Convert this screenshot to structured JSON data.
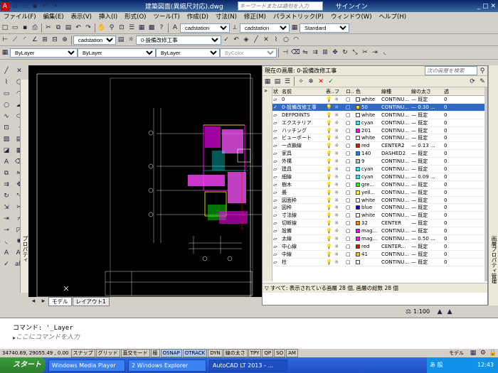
{
  "title": {
    "app_title": "建築図面(異縮尺対応).dwg",
    "search_placeholder": "キーワードまたは語句を入力",
    "signin": "サインイン"
  },
  "menu": [
    "ファイル(F)",
    "編集(E)",
    "表示(V)",
    "挿入(I)",
    "形式(O)",
    "ツール(T)",
    "作成(D)",
    "寸法(N)",
    "修正(M)",
    "パラメトリック(P)",
    "ウィンドウ(W)",
    "ヘルプ(H)"
  ],
  "toolbar": {
    "layer_current": "0-設備改修工事",
    "textstyle": "cadstation",
    "dimstyle": "cadstation",
    "tablestyle": "Standard",
    "multileader": "cadstation",
    "color": "ByLayer",
    "linetype": "ByLayer",
    "lineweight": "ByLayer",
    "plotstyle": "ByColor"
  },
  "palette": {
    "properties_label": "プロパティ",
    "layer_manager_label": "画層プロパティ管理"
  },
  "layers": {
    "current_layer": "現在の画層: 0-設備改修工事",
    "search_placeholder": "次の画層を検索",
    "headers": [
      "状",
      "名前",
      "表..",
      "フリ..",
      "ロ..",
      "色",
      "線種",
      "線の太さ",
      "透"
    ],
    "rows": [
      {
        "name": "0",
        "color": "white",
        "swatch": "#ffffff",
        "ltype": "CONTINU...",
        "lw": "既定",
        "tr": "0",
        "sel": false
      },
      {
        "name": "0-設備改修工事",
        "color": "50",
        "swatch": "#ffd400",
        "ltype": "CONTINU...",
        "lw": "0.30 ...",
        "tr": "0",
        "sel": true
      },
      {
        "name": "DEFPOINTS",
        "color": "white",
        "swatch": "#ffffff",
        "ltype": "CONTINU...",
        "lw": "既定",
        "tr": "0",
        "sel": false
      },
      {
        "name": "エクステリア",
        "color": "cyan",
        "swatch": "#00ffff",
        "ltype": "CONTINU...",
        "lw": "既定",
        "tr": "0",
        "sel": false
      },
      {
        "name": "ハッチング",
        "color": "201",
        "swatch": "#ff00ff",
        "ltype": "CONTINU...",
        "lw": "既定",
        "tr": "0",
        "sel": false
      },
      {
        "name": "ビューポート",
        "color": "white",
        "swatch": "#ffffff",
        "ltype": "CONTINU...",
        "lw": "既定",
        "tr": "0",
        "sel": false
      },
      {
        "name": "一点鎖線",
        "color": "red",
        "swatch": "#ff0000",
        "ltype": "CENTER2",
        "lw": "0.13 ...",
        "tr": "0",
        "sel": false
      },
      {
        "name": "家具",
        "color": "140",
        "swatch": "#0080ff",
        "ltype": "DASHED2",
        "lw": "既定",
        "tr": "0",
        "sel": false
      },
      {
        "name": "外構",
        "color": "9",
        "swatch": "#c0c0c0",
        "ltype": "CONTINU...",
        "lw": "既定",
        "tr": "0",
        "sel": false
      },
      {
        "name": "建具",
        "color": "cyan",
        "swatch": "#00ffff",
        "ltype": "CONTINU...",
        "lw": "既定",
        "tr": "0",
        "sel": false
      },
      {
        "name": "細線",
        "color": "cyan",
        "swatch": "#00ffff",
        "ltype": "CONTINU...",
        "lw": "0.09 ...",
        "tr": "0",
        "sel": false
      },
      {
        "name": "樹木",
        "color": "gre...",
        "swatch": "#00ff00",
        "ltype": "CONTINU...",
        "lw": "既定",
        "tr": "0",
        "sel": false
      },
      {
        "name": "畳",
        "color": "yell...",
        "swatch": "#ffff00",
        "ltype": "CONTINU...",
        "lw": "既定",
        "tr": "0",
        "sel": false
      },
      {
        "name": "図面枠",
        "color": "white",
        "swatch": "#ffffff",
        "ltype": "CONTINU...",
        "lw": "既定",
        "tr": "0",
        "sel": false
      },
      {
        "name": "図枠",
        "color": "blue",
        "swatch": "#0000ff",
        "ltype": "CONTINU...",
        "lw": "既定",
        "tr": "0",
        "sel": false
      },
      {
        "name": "寸法線",
        "color": "white",
        "swatch": "#ffffff",
        "ltype": "CONTINU...",
        "lw": "既定",
        "tr": "0",
        "sel": false
      },
      {
        "name": "切断線",
        "color": "32",
        "swatch": "#ff7f00",
        "ltype": "CENTER",
        "lw": "既定",
        "tr": "0",
        "sel": false
      },
      {
        "name": "設備",
        "color": "mag...",
        "swatch": "#ff00ff",
        "ltype": "CONTINU...",
        "lw": "既定",
        "tr": "0",
        "sel": false
      },
      {
        "name": "太線",
        "color": "mag...",
        "swatch": "#ff00ff",
        "ltype": "CONTINU...",
        "lw": "0.50 ...",
        "tr": "0",
        "sel": false
      },
      {
        "name": "中心線",
        "color": "red",
        "swatch": "#ff0000",
        "ltype": "CENTER...",
        "lw": "既定",
        "tr": "0",
        "sel": false
      },
      {
        "name": "中線",
        "color": "41",
        "swatch": "#ffbf00",
        "ltype": "CONTINU...",
        "lw": "既定",
        "tr": "0",
        "sel": false
      },
      {
        "name": "柱",
        "color": "",
        "swatch": "#ffffff",
        "ltype": "CONTINU...",
        "lw": "既定",
        "tr": "0",
        "sel": false
      }
    ],
    "footer": "すべて: 表示されている画層 28 個, 画層の総数 28 個"
  },
  "layout_tabs": [
    "モデル",
    "レイアウト1"
  ],
  "scale": "1:100",
  "command": {
    "history": "コマンド:  '_Layer",
    "prompt": "ここにコマンドを入力"
  },
  "status": {
    "coords": "34740.69, 29055.49 , 0.00",
    "toggles": [
      "スナップ",
      "グリッド",
      "直交モード",
      "極",
      "OSNAP",
      "OTRACK",
      "DYN",
      "線の太さ",
      "TPY",
      "QP",
      "SO",
      "AM"
    ],
    "on": [
      "OSNAP",
      "OTRACK"
    ],
    "model": "モデル"
  },
  "taskbar": {
    "start": "スタート",
    "tasks": [
      "Windows Media Player",
      "2 Windows Explorer",
      "AutoCAD LT 2013 - ..."
    ],
    "time": "12:43",
    "ime": "あ 般"
  }
}
